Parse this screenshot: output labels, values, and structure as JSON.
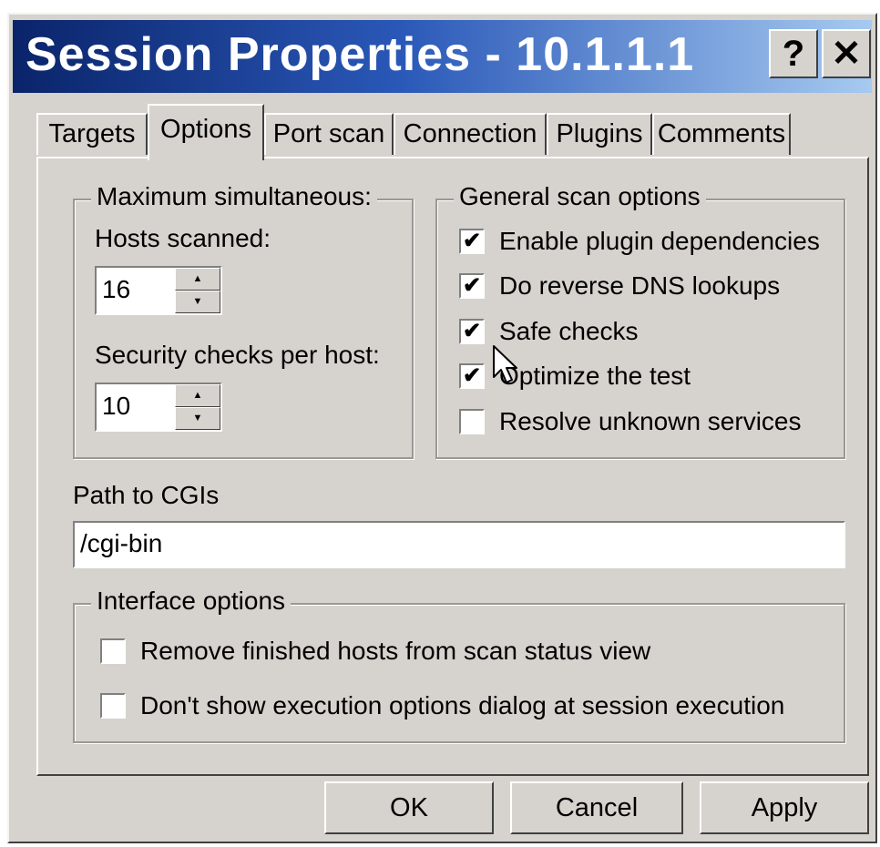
{
  "window": {
    "title": "Session Properties - 10.1.1.1",
    "help_label": "?",
    "close_label": "✕"
  },
  "tabs": [
    {
      "label": "Targets",
      "active": false
    },
    {
      "label": "Options",
      "active": true
    },
    {
      "label": "Port scan",
      "active": false
    },
    {
      "label": "Connection",
      "active": false
    },
    {
      "label": "Plugins",
      "active": false
    },
    {
      "label": "Comments",
      "active": false
    }
  ],
  "max_simultaneous": {
    "legend": "Maximum simultaneous:",
    "hosts_label": "Hosts scanned:",
    "hosts_value": "16",
    "checks_label": "Security checks per host:",
    "checks_value": "10"
  },
  "general_options": {
    "legend": "General scan options",
    "items": [
      {
        "label": "Enable plugin dependencies",
        "checked": true
      },
      {
        "label": "Do reverse DNS lookups",
        "checked": true
      },
      {
        "label": "Safe checks",
        "checked": true
      },
      {
        "label": "Optimize the test",
        "checked": true
      },
      {
        "label": "Resolve unknown services",
        "checked": false
      }
    ]
  },
  "cgi": {
    "label": "Path to CGIs",
    "value": "/cgi-bin"
  },
  "interface_options": {
    "legend": "Interface options",
    "items": [
      {
        "label": "Remove finished hosts from scan status view",
        "checked": false
      },
      {
        "label": "Don't show execution options dialog at session execution",
        "checked": false
      }
    ]
  },
  "buttons": {
    "ok": "OK",
    "cancel": "Cancel",
    "apply": "Apply"
  },
  "icons": {
    "spin_up": "▲",
    "spin_down": "▼",
    "check": "✔"
  }
}
